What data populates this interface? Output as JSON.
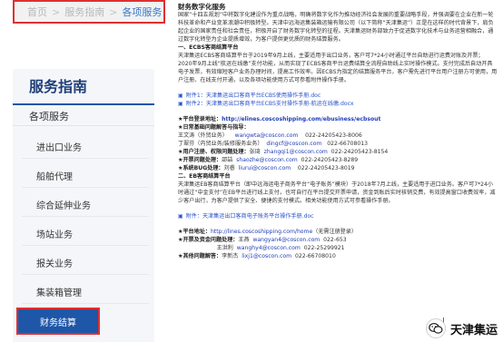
{
  "breadcrumb": {
    "items": [
      "首页",
      "服务指南",
      "各项服务"
    ],
    "separator": ">"
  },
  "sidebar": {
    "title": "服务指南",
    "category": "各项服务",
    "items": [
      {
        "label": "进出口业务"
      },
      {
        "label": "船舶代理"
      },
      {
        "label": "综合延伸业务"
      },
      {
        "label": "场站业务"
      },
      {
        "label": "报关业务"
      },
      {
        "label": "集装箱管理"
      },
      {
        "label": "财务结算"
      }
    ]
  },
  "content": {
    "title": "财务数字化服务",
    "intro": "国家“十四五规划”中将数字化建设作为重点战略，明确将数字化作为推动经济社会发展的重要战略手段，并强调要在企业在新一轮科技革命和产业变革浪潮中积极转型。天津中远海运集装箱运输有限公司（以下简称“天津集运”）正是在这样的时代背景下，肩负起企业的国家责任和社会责任，积极开启了财务数字化转型的征程。天津集运财务部致力于促进数字化技术与业务运营相融合，通过数字化转型为企业提质增效，为客户提供更优质的财务结算服务。",
    "section1": {
      "heading": "一、ECBS客商结算平台",
      "body": "天津集运ECBS客商结算平台于2019年9月上线，主要适用于出口业务，客户可7*24小时通过平台自助进行运费对账及开票；2020年9月上线“航运在线缴”支付功能，从而实现了ECBS客商平台运费结算全流程自助线上实时操作模式。支付完成后自动开具电子发票，有效缩短客户业务办理时间，提高工作效率。因ECBS为指定的结算服务平台，客户需先进行平台用户注册方可使用，用户注册、在线支付开通，以及各项功能使用方式可参看附件操作手册。",
      "attachments": [
        {
          "label": "附件1：天津集运出口客商平台ECBS使用操作手册.doc"
        },
        {
          "label": "附件2：天津集运出口客商平台ECBS支付操作手册-航运在线缴.docx"
        }
      ],
      "login_key": "★平台登录地址：",
      "login_url": "http://elines.coscoshipping.com/ebusiness/ecbsout",
      "contacts_key": "★日常基础问题解答与指导：",
      "contacts": [
        {
          "name": "王文涛（外贸业务）",
          "email": "wangwta@coscon.com",
          "phone": "022-24205423-8006"
        },
        {
          "name": "丁翠芬（内贸业务/装修服务业务）",
          "email": "dingcf@coscon.com",
          "phone": "022-66708013"
        }
      ],
      "auth_key": "★用户注册、权限问题处理：",
      "auth_name": "张琦",
      "auth_email": "zhangqi1@coscon.com",
      "auth_phone": "022-24205423-8154",
      "invoice_key": "★开票问题处理：",
      "invoice_name": "邵喆",
      "invoice_email": "shaozhe@coscon.com",
      "invoice_phone": "022-24205423-8289",
      "bug_key": "★系统BUG处理：",
      "bug_name": "刘睿",
      "bug_email": "liurui@coscon.com",
      "bug_phone": "022-24205423-8019"
    },
    "section2": {
      "heading": "二、EB客商结算平台",
      "body": "天津集运EB客商结算平台（即中远海运电子商务平台“电子账务”模块）于2018年7月上线，主要适用于进口业务。客户可7*24小时通过“中金支付”在EB平台进行线上支付，也可自行在平台提交开票申请，资金到账后实时核销交费，有效提高窗口收费效率，减少客户出行，为客户提供了安全、便捷的支付模式。相关功能使用方式可参看操作手册。",
      "attachments": [
        {
          "label": "附件：天津集运出口客商电子账务平台操作手册.doc"
        }
      ],
      "url_key": "★平台地址：",
      "url": "http://lines.coscoshipping.com/home",
      "url_note": "（无需注册登录）",
      "invoice_key": "★开票及资金问题处理：",
      "invoice_name": "王燕",
      "invoice_email": "wangyan4@coscon.com",
      "invoice_phone": "022-653",
      "contact2_name": "王洪利",
      "contact2_email": "wanghy4@coscon.com",
      "contact2_phone": "022-25299921",
      "other_key": "★其他问题解答：",
      "other_name": "李新杰",
      "other_email": "lixj1@coscon.com",
      "other_phone": "022-66708010"
    }
  },
  "watermark": {
    "text": "天津集运"
  },
  "colors": {
    "accent": "#1e56a8",
    "highlight": "#e03030",
    "link": "#2952c8"
  }
}
